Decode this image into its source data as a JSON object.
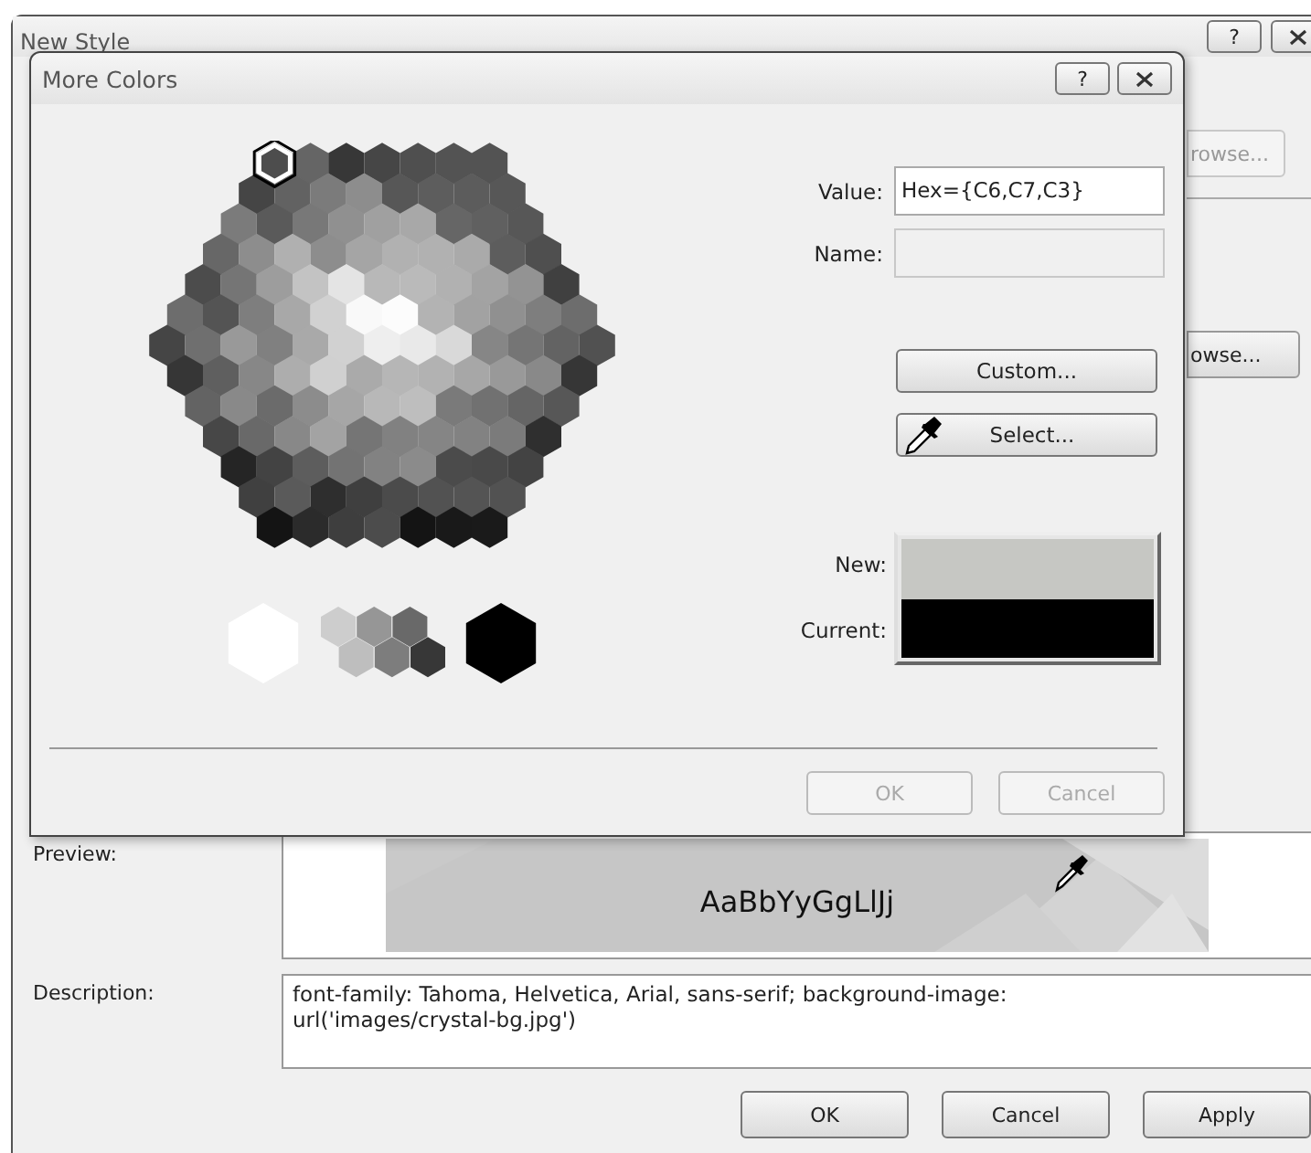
{
  "background_window": {
    "title": "New Style",
    "help_button": "?",
    "partial_buttons": [
      {
        "label": "rowse...",
        "disabled": true
      },
      {
        "label": "owse...",
        "disabled": false
      }
    ],
    "preview": {
      "label": "Preview:",
      "sample": "AaBbYyGgLlJj"
    },
    "description": {
      "label": "Description:",
      "value": "font-family: Tahoma, Helvetica, Arial, sans-serif; background-image: url('images/crystal-bg.jpg')"
    },
    "buttons": [
      "OK",
      "Cancel",
      "Apply"
    ]
  },
  "dialog": {
    "title": "More Colors",
    "help_button": "?",
    "value": {
      "label": "Value:",
      "value": "Hex={C6,C7,C3}"
    },
    "name": {
      "label": "Name:",
      "disabled": true
    },
    "custom_button": "Custom...",
    "select_button": "Select...",
    "new": {
      "label": "New:",
      "color": "#c6c7c3"
    },
    "current": {
      "label": "Current:",
      "color": "#000000"
    },
    "buttons": [
      {
        "label": "OK",
        "disabled": true
      },
      {
        "label": "Cancel",
        "disabled": true
      }
    ]
  }
}
